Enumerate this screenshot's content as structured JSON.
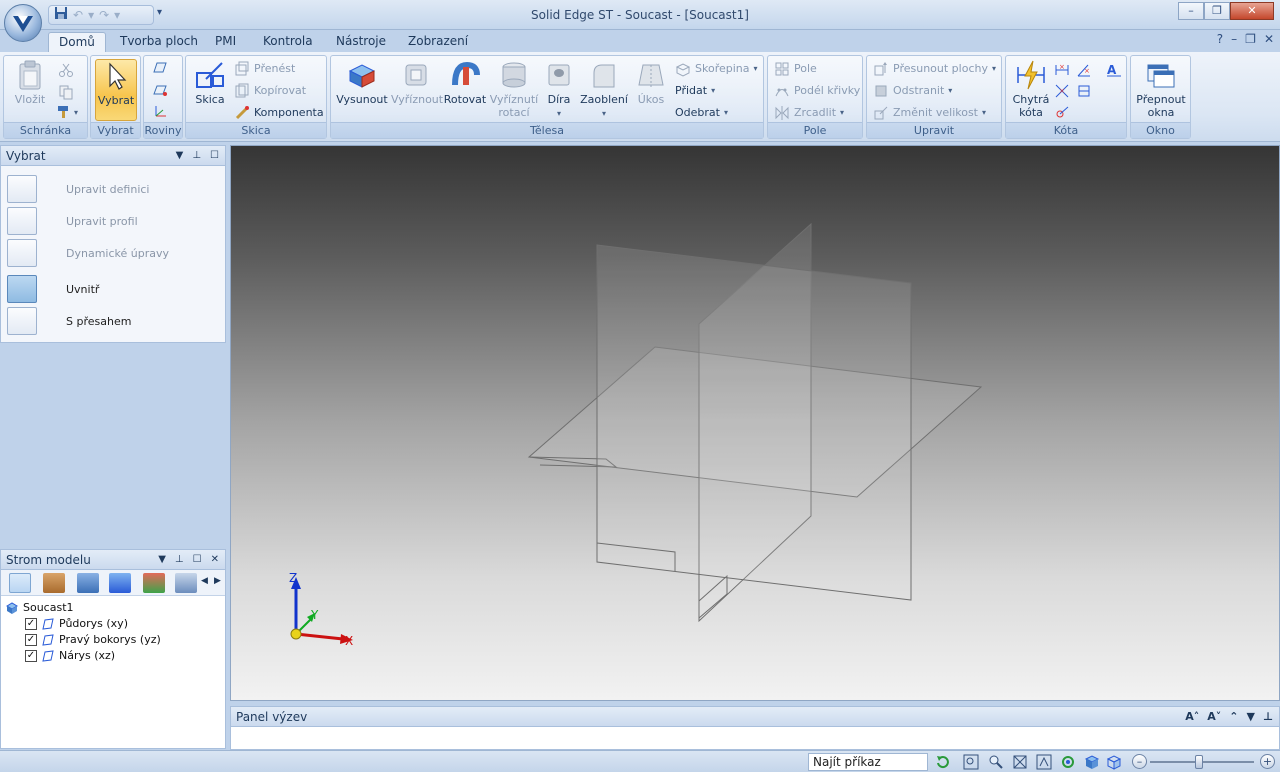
{
  "window": {
    "title": "Solid Edge ST - Soucast - [Soucast1]",
    "min": "–",
    "max": "❐",
    "close": "✕"
  },
  "qat": {
    "more": "▾"
  },
  "tabs": [
    "Domů",
    "Tvorba ploch",
    "PMI",
    "Kontrola",
    "Nástroje",
    "Zobrazení"
  ],
  "tab_controls": {
    "help": "?",
    "min": "–",
    "restore": "❐",
    "close": "✕"
  },
  "ribbon": {
    "groups": {
      "schranka": "Schránka",
      "vybrat": "Vybrat",
      "roviny": "Roviny",
      "skica": "Skica",
      "telesa": "Tělesa",
      "pole": "Pole",
      "upravit": "Upravit",
      "kota": "Kóta",
      "okno": "Okno"
    },
    "vlozit": "Vložit",
    "vybrat_btn": "Vybrat",
    "skica_btn": "Skica",
    "prenest": "Přenést",
    "kopirovat": "Kopírovat",
    "komponenta": "Komponenta",
    "vysunout": "Vysunout",
    "vyriznout": "Vyříznout",
    "rotovat": "Rotovat",
    "vyriznuti_rotaci": "Vyříznutí\nrotací",
    "dira": "Díra",
    "zaobleni": "Zaoblení",
    "ukos": "Úkos",
    "skorepina": "Skořepina",
    "pridat": "Přidat",
    "odebrat": "Odebrat",
    "pole_btn": "Pole",
    "podel_krivky": "Podél křivky",
    "zrcadlit": "Zrcadlit",
    "presunout_plochy": "Přesunout plochy",
    "odstranit": "Odstranit",
    "zmenit_velikost": "Změnit velikost",
    "chytra_kota": "Chytrá\nkóta",
    "prepnout_okna": "Přepnout\nokna"
  },
  "select_panel": {
    "title": "Vybrat",
    "items": [
      {
        "label": "Upravit definici",
        "enabled": false
      },
      {
        "label": "Upravit profil",
        "enabled": false
      },
      {
        "label": "Dynamické úpravy",
        "enabled": false
      },
      {
        "label": "Uvnitř",
        "enabled": true,
        "active": true
      },
      {
        "label": "S přesahem",
        "enabled": true,
        "active": false
      }
    ]
  },
  "model_tree": {
    "title": "Strom modelu",
    "root": "Soucast1",
    "items": [
      {
        "label": "Půdorys (xy)",
        "checked": true
      },
      {
        "label": "Pravý bokorys (yz)",
        "checked": true
      },
      {
        "label": "Nárys (xz)",
        "checked": true
      }
    ]
  },
  "viewport": {
    "axes": {
      "x": "X",
      "y": "Y",
      "z": "Z"
    }
  },
  "command_panel": {
    "title": "Panel výzev"
  },
  "status": {
    "find_command": "Najít příkaz",
    "zoom_minus": "–",
    "zoom_plus": "+"
  },
  "colors": {
    "accent": "#f7c54d",
    "ribbon": "#dbe6f4",
    "frame": "#bfd2ea"
  }
}
